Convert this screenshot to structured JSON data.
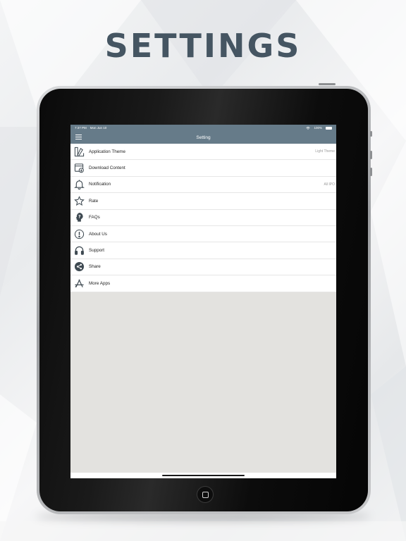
{
  "headline": "SETTINGS",
  "status_bar": {
    "time": "7:37 PM",
    "date": "Mon Jun 10",
    "battery": "100%"
  },
  "nav": {
    "title": "Setting"
  },
  "menu": [
    {
      "label": "Application Theme",
      "value": "Light Theme",
      "icon": "theme-palette-icon"
    },
    {
      "label": "Download Content",
      "value": "",
      "icon": "download-icon"
    },
    {
      "label": "Notification",
      "value": "All IPO",
      "icon": "bell-icon"
    },
    {
      "label": "Rate",
      "value": "",
      "icon": "star-icon"
    },
    {
      "label": "FAQs",
      "value": "",
      "icon": "faq-icon"
    },
    {
      "label": "About Us",
      "value": "",
      "icon": "info-icon"
    },
    {
      "label": "Support",
      "value": "",
      "icon": "headphones-icon"
    },
    {
      "label": "Share",
      "value": "",
      "icon": "share-icon"
    },
    {
      "label": "More Apps",
      "value": "",
      "icon": "app-store-icon"
    }
  ],
  "colors": {
    "headline": "#455562",
    "nav_bar": "#667b89",
    "icon": "#3f4a52",
    "background_fill": "#e3e2df"
  }
}
